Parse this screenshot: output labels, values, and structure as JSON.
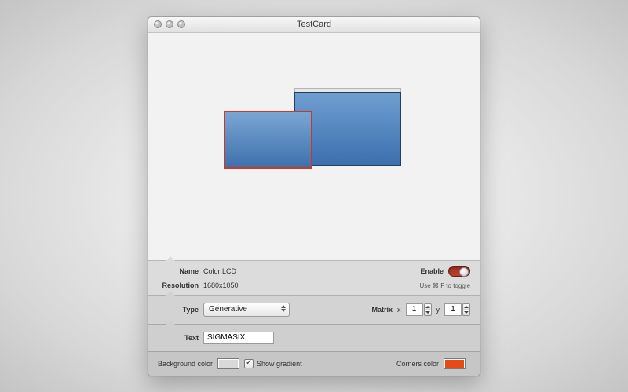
{
  "window": {
    "title": "TestCard"
  },
  "info": {
    "name_label": "Name",
    "name_value": "Color LCD",
    "resolution_label": "Resolution",
    "resolution_value": "1680x1050",
    "enable_label": "Enable",
    "enable_on": true,
    "hint": "Use ⌘ F to toggle"
  },
  "type": {
    "label": "Type",
    "value": "Generative",
    "matrix_label": "Matrix",
    "x_label": "x",
    "x_value": "1",
    "y_label": "y",
    "y_value": "1"
  },
  "text": {
    "label": "Text",
    "value": "SIGMASIX"
  },
  "colors": {
    "bg_label": "Background color",
    "bg_hex": "#d9d9d9",
    "gradient_label": "Show gradient",
    "gradient_checked": true,
    "corners_label": "Corners color",
    "corners_hex": "#e84a17"
  }
}
